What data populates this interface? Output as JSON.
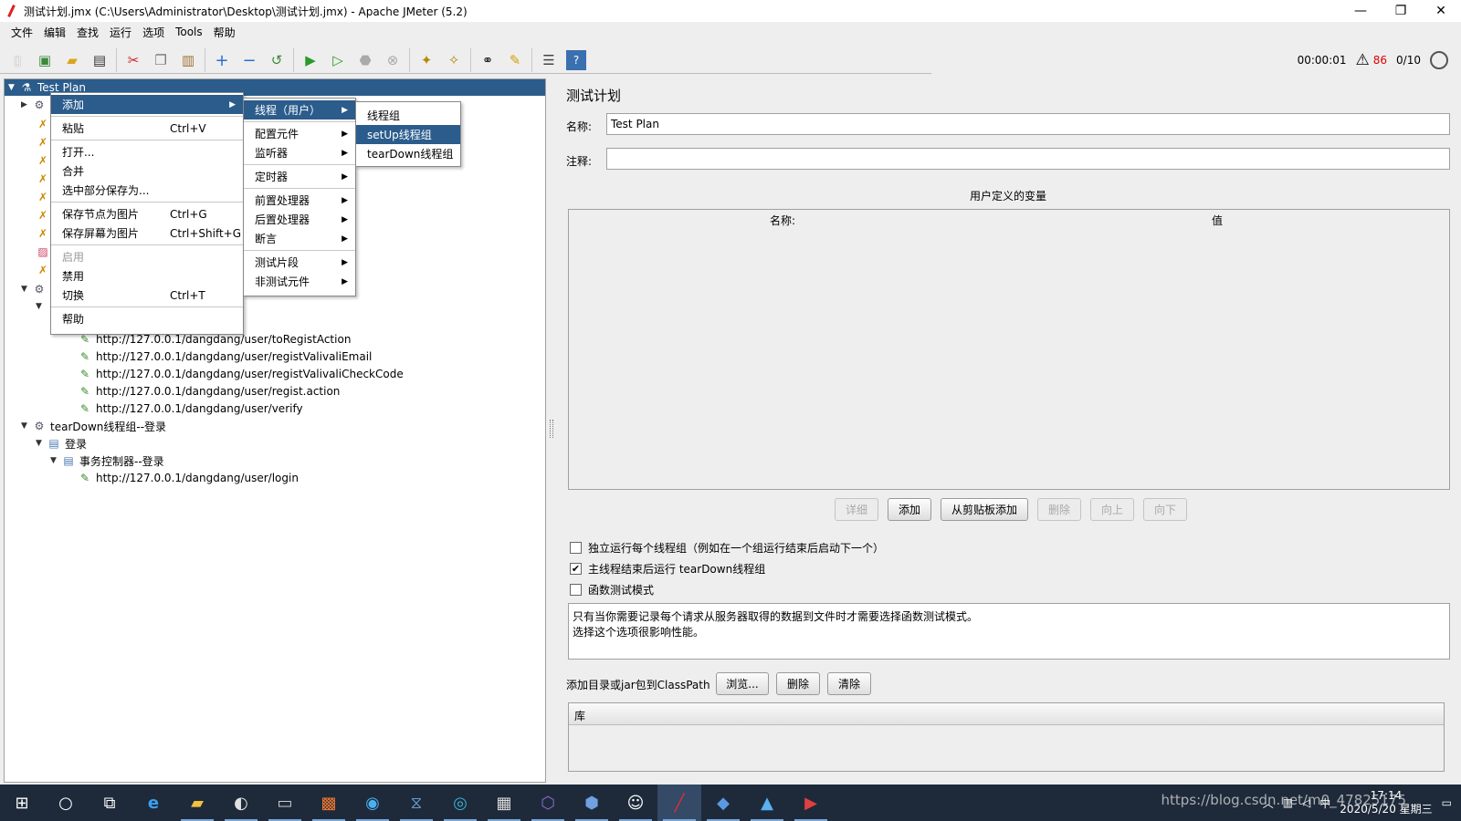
{
  "window": {
    "title": "测试计划.jmx (C:\\Users\\Administrator\\Desktop\\测试计划.jmx) - Apache JMeter (5.2)",
    "minimize": "—",
    "restore": "❐",
    "close": "✕"
  },
  "menubar": [
    "文件",
    "编辑",
    "查找",
    "运行",
    "选项",
    "Tools",
    "帮助"
  ],
  "toolbar": {
    "icons": [
      "new-icon",
      "templates-icon",
      "open-icon",
      "save-icon",
      "cut-icon",
      "copy-icon",
      "paste-icon",
      "expand-icon",
      "collapse-icon",
      "toggle-icon",
      "start-icon",
      "start-no-pause-icon",
      "stop-icon",
      "shutdown-icon",
      "clear-icon",
      "clear-all-icon",
      "search-icon",
      "reset-search-icon",
      "function-helper-icon",
      "help-icon"
    ],
    "elapsed": "00:00:01",
    "warnings": "86",
    "threads": "0/10"
  },
  "tree": {
    "root": "Test Plan",
    "items": [
      "http://127.0.0.1/dangdang/user/toRegistAction",
      "http://127.0.0.1/dangdang/user/registValivaliEmail",
      "http://127.0.0.1/dangdang/user/registValivaliCheckCode",
      "http://127.0.0.1/dangdang/user/regist.action",
      "http://127.0.0.1/dangdang/user/verify"
    ],
    "teardown_group": "tearDown线程组--登录",
    "login_item": "登录",
    "transaction": "事务控制器--登录",
    "login_sampler": "http://127.0.0.1/dangdang/user/login"
  },
  "context_menu": {
    "add": "添加",
    "paste": "粘贴",
    "paste_sc": "Ctrl+V",
    "open": "打开...",
    "merge": "合并",
    "save_selection": "选中部分保存为...",
    "save_node_image": "保存节点为图片",
    "save_node_image_sc": "Ctrl+G",
    "save_screen_image": "保存屏幕为图片",
    "save_screen_image_sc": "Ctrl+Shift+G",
    "enable": "启用",
    "disable": "禁用",
    "toggle": "切换",
    "toggle_sc": "Ctrl+T",
    "help": "帮助"
  },
  "submenu_add": {
    "threads": "线程（用户）",
    "config": "配置元件",
    "listener": "监听器",
    "timer": "定时器",
    "pre": "前置处理器",
    "post": "后置处理器",
    "assert": "断言",
    "fragment": "测试片段",
    "non_test": "非测试元件"
  },
  "submenu_threads": {
    "thread_group": "线程组",
    "setup": "setUp线程组",
    "teardown": "tearDown线程组"
  },
  "plan": {
    "heading": "测试计划",
    "name_label": "名称:",
    "name_value": "Test Plan",
    "comment_label": "注释:",
    "comment_value": "",
    "vars_title": "用户定义的变量",
    "col_name": "名称:",
    "col_value": "值",
    "btn_detail": "详细",
    "btn_add": "添加",
    "btn_add_clip": "从剪贴板添加",
    "btn_delete": "删除",
    "btn_up": "向上",
    "btn_down": "向下",
    "cb_serial": "独立运行每个线程组（例如在一个组运行结束后启动下一个）",
    "cb_serial_checked": false,
    "cb_teardown": "主线程结束后运行 tearDown线程组",
    "cb_teardown_checked": true,
    "cb_functional": "函数测试模式",
    "cb_functional_checked": false,
    "info_line1": "只有当你需要记录每个请求从服务器取得的数据到文件时才需要选择函数测试模式。",
    "info_line2": "选择这个选项很影响性能。",
    "classpath_label": "添加目录或jar包到ClassPath",
    "btn_browse": "浏览...",
    "btn_cp_delete": "删除",
    "btn_clear": "清除",
    "lib_header": "库"
  },
  "taskbar": {
    "apps": [
      "start-icon",
      "search-icon",
      "task-view-icon",
      "edge-icon",
      "explorer-icon",
      "app-icon",
      "terminal-icon",
      "xampp-icon",
      "browser-icon",
      "code-icon",
      "network-icon",
      "window-icon",
      "vs-icon",
      "cloud-icon",
      "qq-icon",
      "jmeter-icon",
      "vscode-icon",
      "photo-icon",
      "media-icon"
    ],
    "ime": "中",
    "time": "17:14",
    "date": "2020/5/20 星期三",
    "watermark": "https://blog.csdn.net/m0_47825175"
  }
}
